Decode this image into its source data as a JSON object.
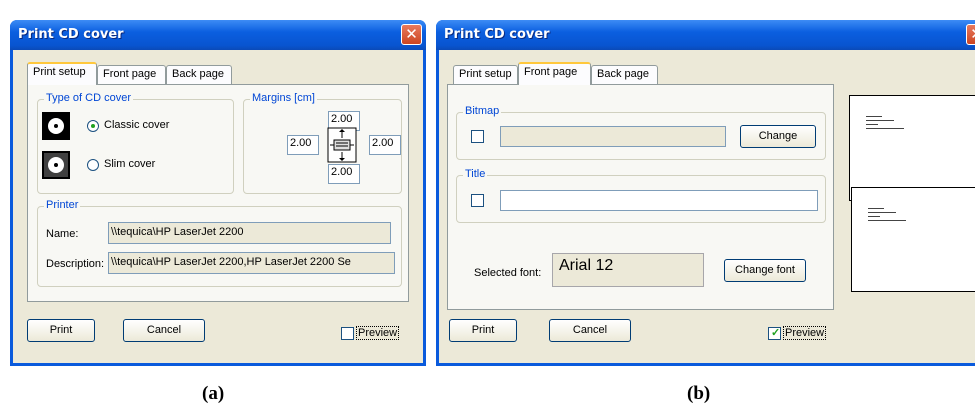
{
  "captions": {
    "a": "(a)",
    "b": "(b)"
  },
  "dialog_a": {
    "title": "Print CD cover",
    "close_glyph": "✕",
    "tabs": [
      "Print setup",
      "Front page",
      "Back page"
    ],
    "active_tab": "Print setup",
    "cover_group": {
      "title": "Type of CD cover",
      "options": [
        {
          "label": "Classic cover",
          "selected": true
        },
        {
          "label": "Slim cover",
          "selected": false
        }
      ]
    },
    "margins_group": {
      "title": "Margins [cm]",
      "top": "2.00",
      "left": "2.00",
      "right": "2.00",
      "bottom": "2.00"
    },
    "printer_group": {
      "title": "Printer",
      "name_label": "Name:",
      "name_value": "\\\\tequica\\HP LaserJet 2200",
      "description_label": "Description:",
      "description_value": "\\\\tequica\\HP LaserJet 2200,HP LaserJet 2200 Se"
    },
    "print_button": "Print",
    "cancel_button": "Cancel",
    "preview_label": "Preview",
    "preview_checked": false
  },
  "dialog_b": {
    "title": "Print CD cover",
    "close_glyph": "✕",
    "tabs": [
      "Print setup",
      "Front page",
      "Back page"
    ],
    "active_tab": "Front page",
    "bitmap_group": {
      "title": "Bitmap",
      "checked": false,
      "value": "",
      "change_button": "Change"
    },
    "title_group": {
      "title": "Title",
      "checked": false,
      "value": ""
    },
    "selected_font_label": "Selected font:",
    "selected_font_value": "Arial 12",
    "change_font_button": "Change font",
    "print_button": "Print",
    "cancel_button": "Cancel",
    "preview_label": "Preview",
    "preview_checked": true
  },
  "colors": {
    "titlebar": "#0a5adc",
    "dialog_bg": "#ece9d8",
    "group_title": "#0046d5",
    "close": "#cc4521"
  }
}
